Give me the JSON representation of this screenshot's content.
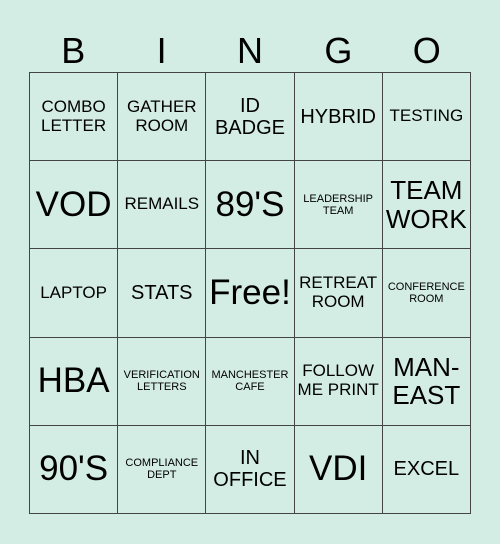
{
  "header": [
    "B",
    "I",
    "N",
    "G",
    "O"
  ],
  "cells": [
    {
      "text": "COMBO LETTER",
      "size": "s2"
    },
    {
      "text": "GATHER ROOM",
      "size": "s2"
    },
    {
      "text": "ID BADGE",
      "size": "s3"
    },
    {
      "text": "HYBRID",
      "size": "s3"
    },
    {
      "text": "TESTING",
      "size": "s2"
    },
    {
      "text": "VOD",
      "size": "s5"
    },
    {
      "text": "REMAILS",
      "size": "s2"
    },
    {
      "text": "89'S",
      "size": "s5"
    },
    {
      "text": "LEADERSHIP TEAM",
      "size": "s1"
    },
    {
      "text": "TEAM WORK",
      "size": "s4"
    },
    {
      "text": "LAPTOP",
      "size": "s2"
    },
    {
      "text": "STATS",
      "size": "s3"
    },
    {
      "text": "Free!",
      "size": "s5"
    },
    {
      "text": "RETREAT ROOM",
      "size": "s2"
    },
    {
      "text": "CONFERENCE ROOM",
      "size": "s1"
    },
    {
      "text": "HBA",
      "size": "s5"
    },
    {
      "text": "VERIFICATION LETTERS",
      "size": "s1"
    },
    {
      "text": "MANCHESTER CAFE",
      "size": "s1"
    },
    {
      "text": "FOLLOW ME PRINT",
      "size": "s2"
    },
    {
      "text": "MAN-EAST",
      "size": "s4"
    },
    {
      "text": "90'S",
      "size": "s5"
    },
    {
      "text": "COMPLIANCE DEPT",
      "size": "s1"
    },
    {
      "text": "IN OFFICE",
      "size": "s3"
    },
    {
      "text": "VDI",
      "size": "s5"
    },
    {
      "text": "EXCEL",
      "size": "s3"
    }
  ]
}
